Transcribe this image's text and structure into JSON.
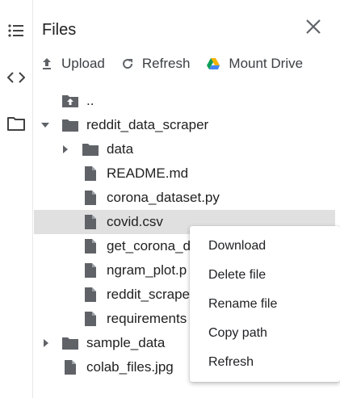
{
  "panel": {
    "title": "Files"
  },
  "toolbar": {
    "upload_label": "Upload",
    "refresh_label": "Refresh",
    "mount_drive_label": "Mount Drive"
  },
  "icons": {
    "rail": [
      "list-icon",
      "code-icon",
      "folder-icon"
    ],
    "close": "close-icon",
    "upload": "upload-icon",
    "refresh": "refresh-icon",
    "drive": "google-drive-icon"
  },
  "tree": [
    {
      "label": "..",
      "type": "parent-folder",
      "depth": 0
    },
    {
      "label": "reddit_data_scraper",
      "type": "folder",
      "expanded": true,
      "depth": 0
    },
    {
      "label": "data",
      "type": "folder",
      "expanded": false,
      "depth": 1
    },
    {
      "label": "README.md",
      "type": "file",
      "depth": 1
    },
    {
      "label": "corona_dataset.py",
      "type": "file",
      "depth": 1
    },
    {
      "label": "covid.csv",
      "type": "file",
      "depth": 1,
      "selected": true
    },
    {
      "label": "get_corona_d",
      "type": "file",
      "depth": 1
    },
    {
      "label": "ngram_plot.p",
      "type": "file",
      "depth": 1
    },
    {
      "label": "reddit_scrape",
      "type": "file",
      "depth": 1
    },
    {
      "label": "requirements",
      "type": "file",
      "depth": 1
    },
    {
      "label": "sample_data",
      "type": "folder",
      "expanded": false,
      "depth": 0
    },
    {
      "label": "colab_files.jpg",
      "type": "file",
      "depth": 0
    }
  ],
  "context_menu": {
    "items": [
      "Download",
      "Delete file",
      "Rename file",
      "Copy path",
      "Refresh"
    ]
  },
  "colors": {
    "selected_row": "#e0e0e0",
    "icon_gray": "#5f6368",
    "drive_green": "#0f9d58",
    "drive_yellow": "#f4b400",
    "drive_blue": "#4285f4"
  }
}
